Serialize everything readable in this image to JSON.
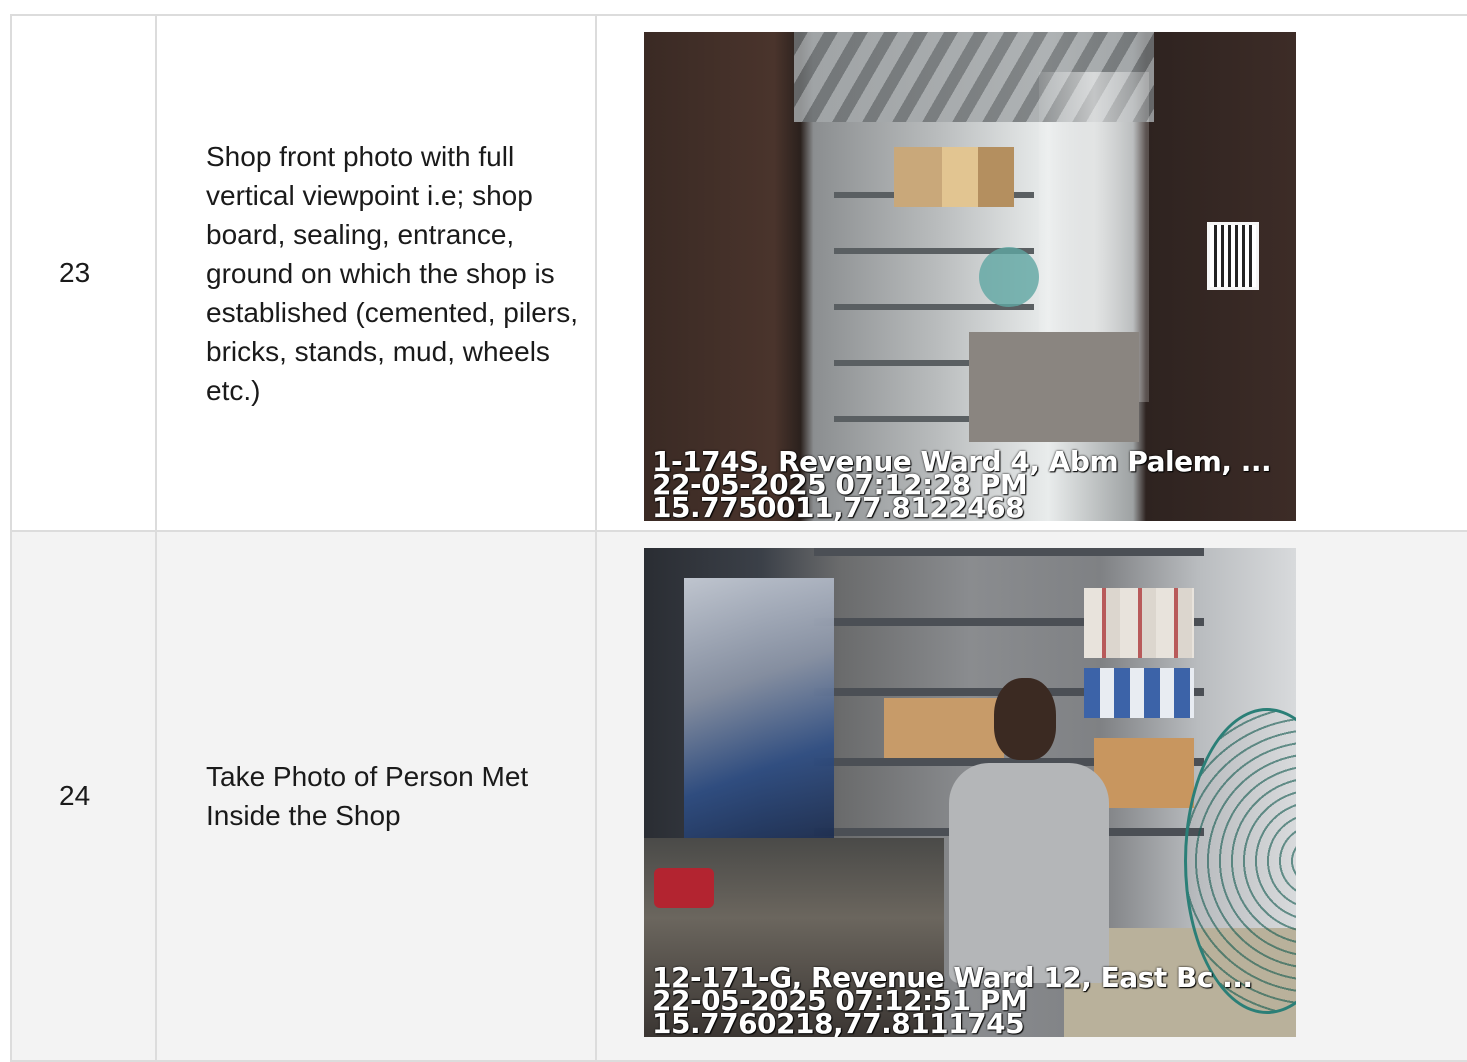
{
  "rows": [
    {
      "number": "23",
      "description": "Shop front photo with full vertical viewpoint i.e; shop board, sealing, entrance, ground on which the shop is established (cemented, pilers, bricks, stands, mud, wheels etc.)",
      "photo": {
        "address": "1-174S, Revenue Ward 4, Abm Palem, ...",
        "datetime": "22-05-2025 07:12:28 PM",
        "coordinates": "15.7750011,77.8122468"
      }
    },
    {
      "number": "24",
      "description": "Take Photo of Person Met Inside the Shop",
      "photo": {
        "address": "12-171-G, Revenue Ward 12, East Bc ...",
        "datetime": "22-05-2025 07:12:51 PM",
        "coordinates": "15.7760218,77.8111745"
      }
    }
  ]
}
